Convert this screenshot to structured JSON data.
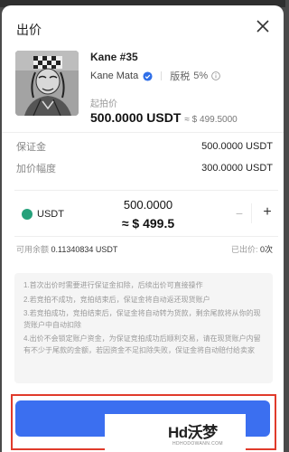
{
  "header": {
    "title": "出价"
  },
  "nft": {
    "name": "Kane #35",
    "creator": "Kane Mata",
    "royalty_label": "版税",
    "royalty_value": "5%",
    "start_price_label": "起拍价",
    "start_price": "500.0000 USDT",
    "start_price_approx": "≈ $ 499.5000"
  },
  "summary": {
    "deposit_label": "保证金",
    "deposit_value": "500.0000 USDT",
    "increment_label": "加价幅度",
    "increment_value": "300.0000 USDT"
  },
  "bid": {
    "currency": "USDT",
    "amount": "500.0000",
    "approx": "≈ $ 499.5",
    "minus": "−",
    "plus": "+"
  },
  "balance": {
    "available_label": "可用余额",
    "available_value": "0.11340834 USDT",
    "bid_count_label": "已出价:",
    "bid_count_value": "0次"
  },
  "rules": [
    "1.首次出价时需要进行保证金扣除，后续出价可直接操作",
    "2.若竞拍不成功，竞拍结束后，保证金将自动返还现货账户",
    "3.若竞拍成功，竞拍结束后，保证金将自动转为货款，剩余尾款将从你的现货账户中自动扣除",
    "4.出价不会锁定账户资金，为保证竞拍成功后顺利交易，请在现货账户内留有不少于尾款的金额，若因资金不足扣除失败，保证金将自动赔付给卖家"
  ],
  "watermark": {
    "text": "Hd沃梦",
    "sub": "HDHODOWANN.COM"
  },
  "colors": {
    "accent": "#3b6ff0",
    "highlight": "#e03b2b",
    "usdt": "#26a17b"
  },
  "icons": {
    "close": "close-icon",
    "verified": "verified-badge-icon",
    "info": "info-icon",
    "coin": "usdt-coin-icon"
  }
}
